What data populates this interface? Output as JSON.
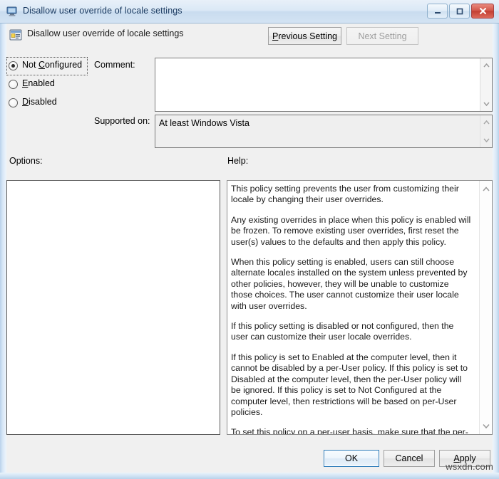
{
  "window": {
    "title": "Disallow user override of locale settings",
    "title_icon": "computer-monitor-icon",
    "controls": {
      "minimize_label": "Minimize",
      "maximize_label": "Maximize",
      "close_label": "Close"
    }
  },
  "header": {
    "icon": "policy-setting-icon",
    "title": "Disallow user override of locale settings",
    "previous_setting_label": "Previous Setting",
    "previous_setting_accel": "P",
    "next_setting_label": "Next Setting",
    "next_setting_enabled": false
  },
  "state_options": [
    {
      "label": "Not Configured",
      "accel": "C",
      "selected": true,
      "focused": true
    },
    {
      "label": "Enabled",
      "accel": "E",
      "selected": false,
      "focused": false
    },
    {
      "label": "Disabled",
      "accel": "D",
      "selected": false,
      "focused": false
    }
  ],
  "comment": {
    "label": "Comment:",
    "value": "",
    "placeholder": ""
  },
  "supported_on": {
    "label": "Supported on:",
    "value": "At least Windows Vista"
  },
  "options": {
    "label": "Options:",
    "items": []
  },
  "help": {
    "label": "Help:",
    "paragraphs": [
      "This policy setting prevents the user from customizing their locale by changing their user overrides.",
      "Any existing overrides in place when this policy is enabled will be frozen. To remove existing user overrides, first reset the user(s) values to the defaults and then apply this policy.",
      "When this policy setting is enabled, users can still choose alternate locales installed on the system unless prevented by other policies, however, they will be unable to customize those choices.  The user cannot customize their user locale with user overrides.",
      "If this policy setting is disabled or not configured, then the user can customize their user locale overrides.",
      "If this policy is set to Enabled at the computer level, then it cannot be disabled by a per-User policy. If this policy is set to Disabled at the computer level, then the per-User policy will be ignored. If this policy is set to Not Configured at the computer level, then restrictions will be based on per-User policies.",
      "To set this policy on a per-user basis, make sure that the per-computer policy is set to Not Configured."
    ]
  },
  "footer": {
    "ok_label": "OK",
    "cancel_label": "Cancel",
    "apply_label": "Apply",
    "apply_accel": "A",
    "default_button": "OK"
  },
  "watermark": "wsxdn.com",
  "colors": {
    "titlebar_text": "#17375e",
    "close_button": "#c23f33",
    "default_button_border": "#2a7ab9",
    "frame": "#cfe2f3"
  }
}
